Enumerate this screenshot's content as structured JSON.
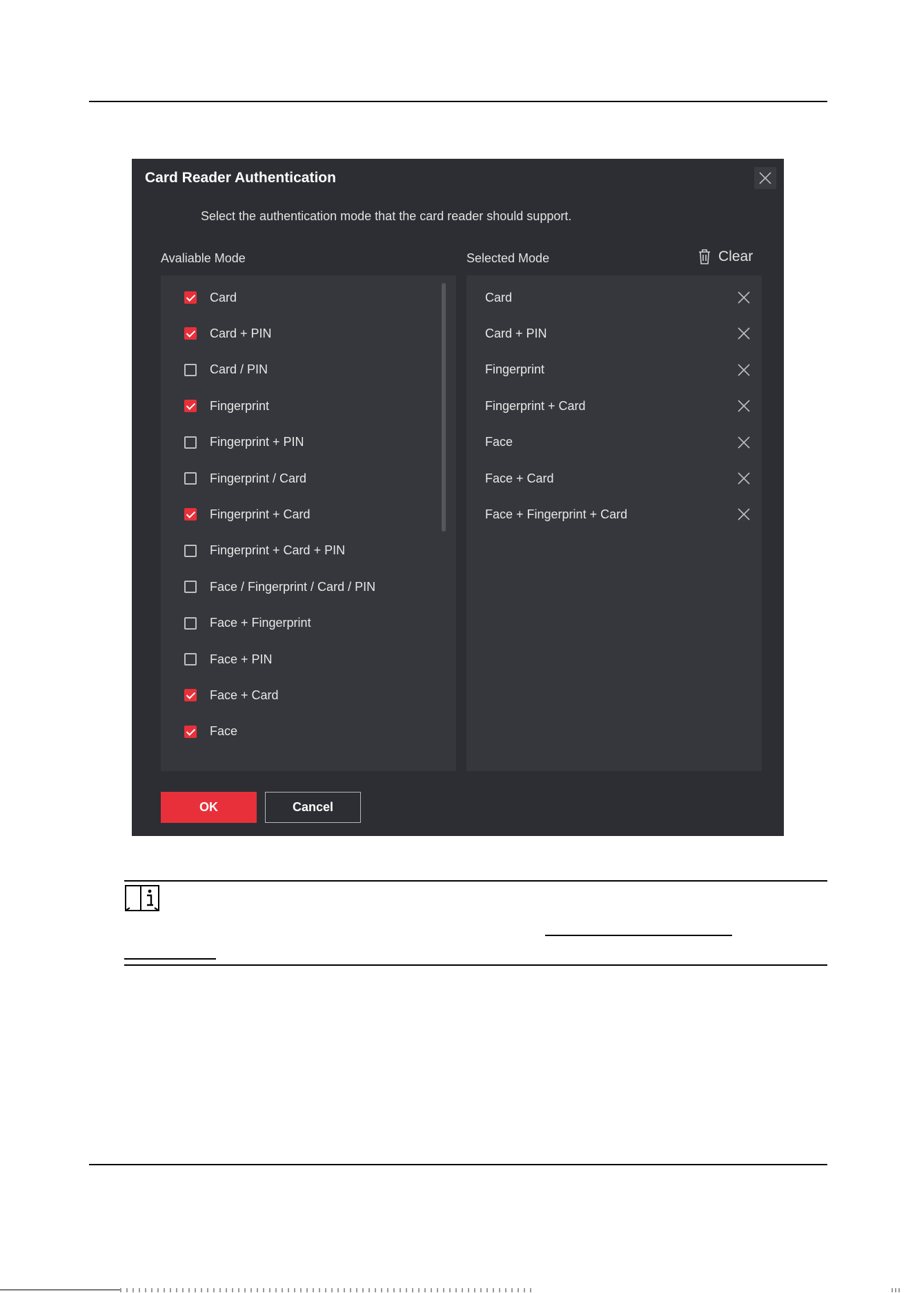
{
  "dialog": {
    "title": "Card Reader Authentication",
    "subtitle": "Select the authentication mode that the card reader should support.",
    "available_label": "Avaliable Mode",
    "selected_label": "Selected Mode",
    "clear_label": "Clear",
    "available": [
      {
        "label": "Card",
        "checked": true
      },
      {
        "label": "Card + PIN",
        "checked": true
      },
      {
        "label": "Card / PIN",
        "checked": false
      },
      {
        "label": "Fingerprint",
        "checked": true
      },
      {
        "label": "Fingerprint + PIN",
        "checked": false
      },
      {
        "label": "Fingerprint / Card",
        "checked": false
      },
      {
        "label": "Fingerprint + Card",
        "checked": true
      },
      {
        "label": "Fingerprint + Card + PIN",
        "checked": false
      },
      {
        "label": "Face / Fingerprint / Card / PIN",
        "checked": false
      },
      {
        "label": "Face + Fingerprint",
        "checked": false
      },
      {
        "label": "Face + PIN",
        "checked": false
      },
      {
        "label": "Face + Card",
        "checked": true
      },
      {
        "label": "Face",
        "checked": true
      }
    ],
    "selected": [
      "Card",
      "Card + PIN",
      "Fingerprint",
      "Fingerprint + Card",
      "Face",
      "Face + Card",
      "Face + Fingerprint + Card"
    ],
    "ok_label": "OK",
    "cancel_label": "Cancel"
  },
  "colors": {
    "dialog_bg": "#2d2e33",
    "panel_bg": "#36373c",
    "accent": "#e8303a"
  }
}
